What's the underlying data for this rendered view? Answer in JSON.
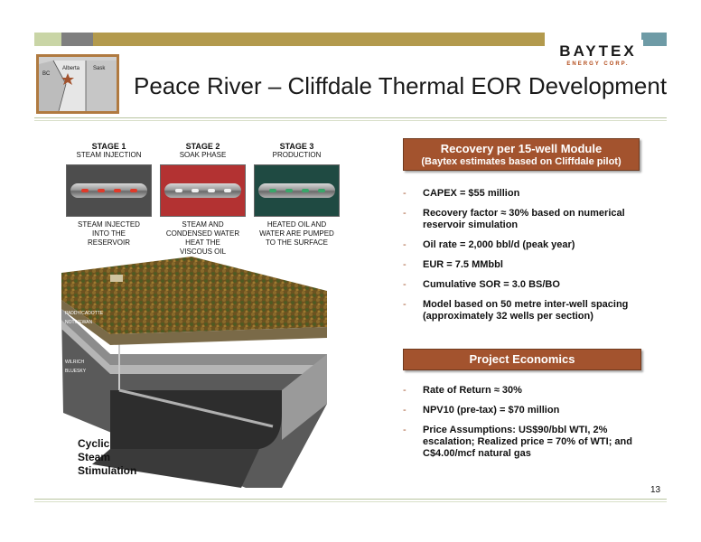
{
  "logo": {
    "name": "BAYTEX",
    "sub": "ENERGY CORP."
  },
  "map": {
    "labels": {
      "bc": "BC",
      "alberta": "Alberta",
      "sask": "Sask"
    }
  },
  "title": "Peace River – Cliffdale Thermal EOR Development",
  "stages": [
    {
      "title": "STAGE 1",
      "subtitle": "STEAM INJECTION",
      "desc": [
        "STEAM INJECTED",
        "INTO THE",
        "RESERVOIR"
      ],
      "bg": "#4d4d4d",
      "dash": "#e03a2a"
    },
    {
      "title": "STAGE 2",
      "subtitle": "SOAK PHASE",
      "desc": [
        "STEAM AND",
        "CONDENSED WATER",
        "HEAT THE",
        "VISCOUS OIL"
      ],
      "bg": "#b33232",
      "dash": "#f2f2f2"
    },
    {
      "title": "STAGE 3",
      "subtitle": "PRODUCTION",
      "desc": [
        "HEATED OIL AND",
        "WATER ARE PUMPED",
        "TO THE SURFACE"
      ],
      "bg": "#1f4a42",
      "dash": "#3aa66a"
    }
  ],
  "layers": {
    "l1": "PADDY/CADOTTE",
    "l2": "NOTIKEWAN",
    "l3": "WILRICH",
    "l4": "BLUESKY"
  },
  "diagram_caption": [
    "Cyclic",
    "Steam",
    "Stimulation"
  ],
  "recovery": {
    "title": "Recovery per 15-well Module",
    "subtitle": "(Baytex estimates based on Cliffdale pilot)",
    "bullets": [
      "CAPEX = $55 million",
      "Recovery factor ≈ 30% based on numerical reservoir simulation",
      "Oil rate = 2,000 bbl/d (peak year)",
      "EUR = 7.5 MMbbl",
      "Cumulative SOR = 3.0 BS/BO",
      "Model based on 50 metre inter-well spacing (approximately 32 wells per section)"
    ]
  },
  "economics": {
    "title": "Project Economics",
    "bullets": [
      "Rate of Return ≈ 30%",
      "NPV10 (pre-tax) = $70 million",
      "Price Assumptions: US$90/bbl WTI, 2% escalation; Realized price = 70% of WTI; and C$4.00/mcf natural gas"
    ]
  },
  "page_number": "13",
  "colors": {
    "accent": "#a3532e",
    "gold_bar": "#b39a4d",
    "teal_bar": "#6e9ba6"
  }
}
